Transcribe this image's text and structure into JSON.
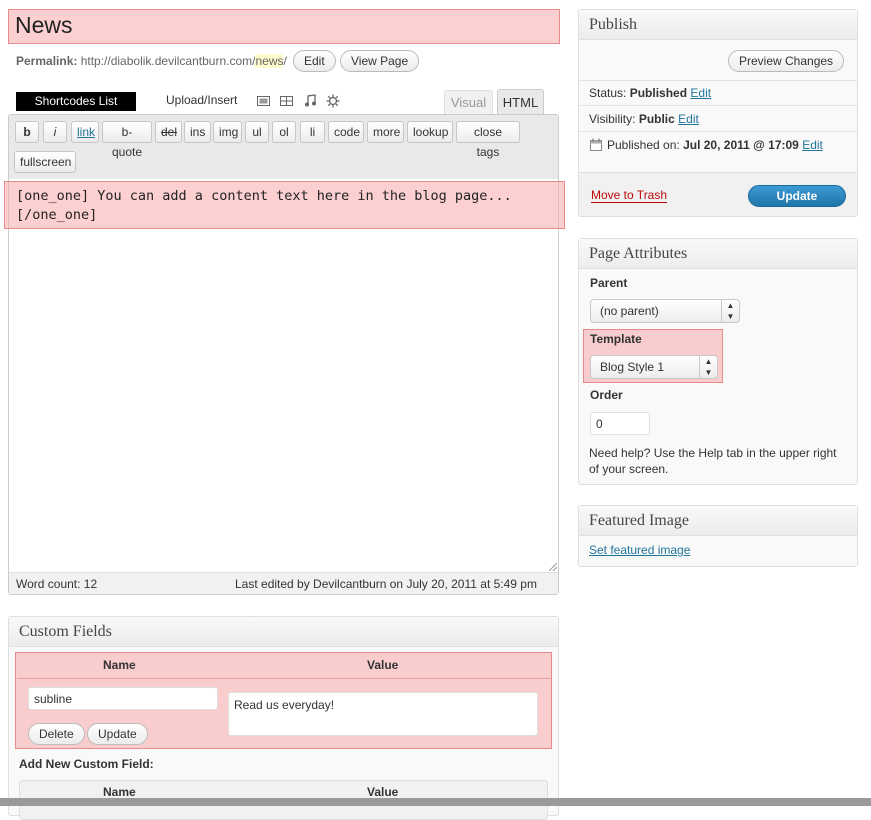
{
  "title": "News",
  "permalink": {
    "label": "Permalink:",
    "base": "http://diabolik.devilcantburn.com/",
    "slug": "news",
    "trailing": "/",
    "edit_label": "Edit",
    "view_label": "View Page"
  },
  "editor": {
    "shortcodes_label": "Shortcodes List",
    "upload_label": "Upload/Insert",
    "tab_visual": "Visual",
    "tab_html": "HTML",
    "quicktags": [
      "b",
      "i",
      "link",
      "b-quote",
      "del",
      "ins",
      "img",
      "ul",
      "ol",
      "li",
      "code",
      "more",
      "lookup",
      "close tags"
    ],
    "fullscreen_label": "fullscreen",
    "content_line1": "[one_one] You can add a content text here in the blog page...",
    "content_line2": "[/one_one]",
    "word_count": "Word count: 12",
    "last_edited": "Last edited by Devilcantburn on July 20, 2011 at 5:49 pm"
  },
  "custom_fields": {
    "title": "Custom Fields",
    "col_name": "Name",
    "col_value": "Value",
    "row_name": "subline",
    "row_value": "Read us everyday!",
    "delete_label": "Delete",
    "update_label": "Update",
    "add_new_label": "Add New Custom Field:",
    "new_col_name": "Name",
    "new_col_value": "Value"
  },
  "publish": {
    "title": "Publish",
    "preview_label": "Preview Changes",
    "status_label": "Status:",
    "status_value": "Published",
    "visibility_label": "Visibility:",
    "visibility_value": "Public",
    "published_label": "Published on:",
    "published_value": "Jul 20, 2011 @ 17:09",
    "edit_label": "Edit",
    "trash_label": "Move to Trash",
    "update_label": "Update",
    "update_color": "#2a87c1"
  },
  "page_attributes": {
    "title": "Page Attributes",
    "parent_label": "Parent",
    "parent_value": "(no parent)",
    "template_label": "Template",
    "template_value": "Blog Style 1",
    "order_label": "Order",
    "order_value": "0",
    "help_line1": "Need help? Use the Help tab in the upper right",
    "help_line2": "of your screen."
  },
  "featured_image": {
    "title": "Featured Image",
    "link_label": "Set featured image"
  }
}
